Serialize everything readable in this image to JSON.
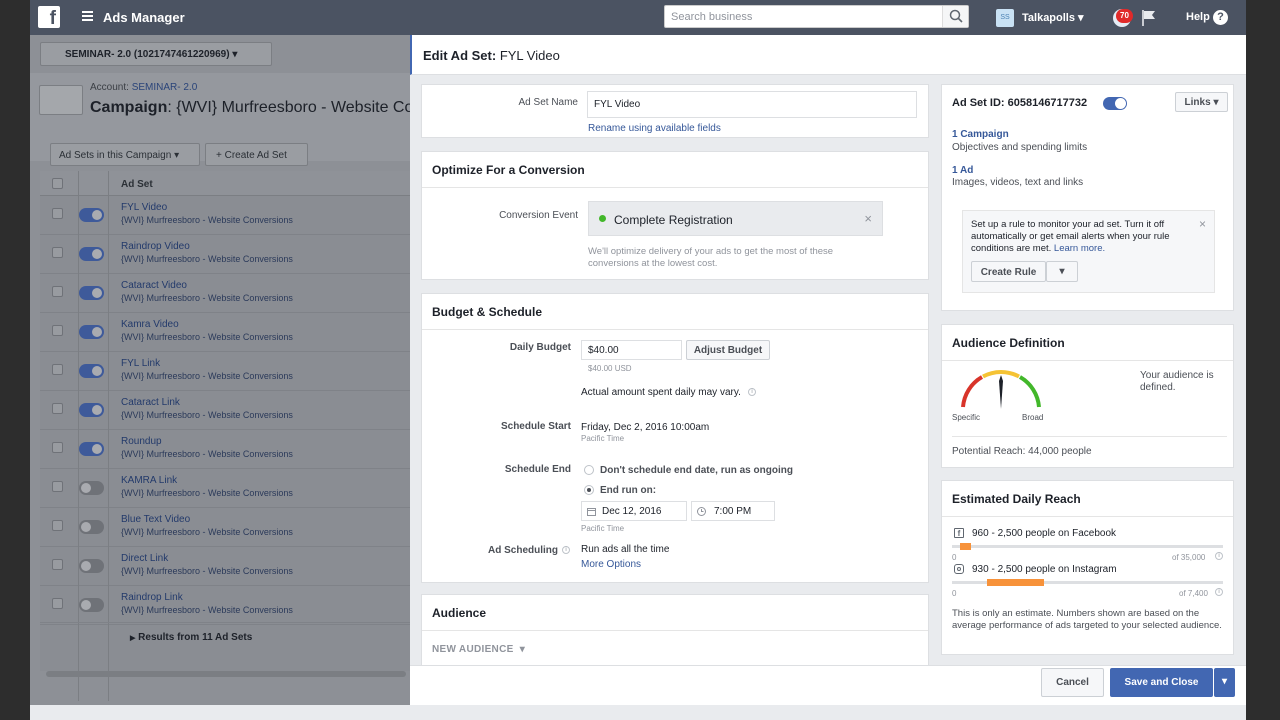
{
  "topbar": {
    "app_title": "Ads Manager",
    "search_placeholder": "Search business",
    "account_initials": "SS",
    "account_name": "Talkapolls",
    "notification_count": "70",
    "help_label": "Help",
    "help_icon": "?"
  },
  "background": {
    "campaign_selector": "SEMINAR- 2.0 (1021747461220969)",
    "account_label": "Account:",
    "account_name": "SEMINAR- 2.0",
    "campaign_label": "Campaign",
    "campaign_name": ": {WVI} Murfreesboro - Website Conv",
    "adsets_button": "Ad Sets in this Campaign",
    "create_button": "Create Ad Set",
    "table_header": "Ad Set",
    "rows": [
      {
        "name": "FYL Video",
        "campaign": "{WVI} Murfreesboro - Website Conversions",
        "active": true
      },
      {
        "name": "Raindrop Video",
        "campaign": "{WVI} Murfreesboro - Website Conversions",
        "active": true
      },
      {
        "name": "Cataract Video",
        "campaign": "{WVI} Murfreesboro - Website Conversions",
        "active": true
      },
      {
        "name": "Kamra Video",
        "campaign": "{WVI} Murfreesboro - Website Conversions",
        "active": true
      },
      {
        "name": "FYL Link",
        "campaign": "{WVI} Murfreesboro - Website Conversions",
        "active": true
      },
      {
        "name": "Cataract Link",
        "campaign": "{WVI} Murfreesboro - Website Conversions",
        "active": true
      },
      {
        "name": "Roundup",
        "campaign": "{WVI} Murfreesboro - Website Conversions",
        "active": true
      },
      {
        "name": "KAMRA Link",
        "campaign": "{WVI} Murfreesboro - Website Conversions",
        "active": false
      },
      {
        "name": "Blue Text Video",
        "campaign": "{WVI} Murfreesboro - Website Conversions",
        "active": false
      },
      {
        "name": "Direct Link",
        "campaign": "{WVI} Murfreesboro - Website Conversions",
        "active": false
      },
      {
        "name": "Raindrop Link",
        "campaign": "{WVI} Murfreesboro - Website Conversions",
        "active": false
      }
    ],
    "results_row": "Results from 11 Ad Sets"
  },
  "panel": {
    "title_prefix": "Edit Ad Set:",
    "title_name": "FYL Video",
    "adset_name_label": "Ad Set Name",
    "adset_name_value": "FYL Video",
    "rename_link": "Rename using available fields",
    "optimize": {
      "heading": "Optimize For a Conversion",
      "event_label": "Conversion Event",
      "event_value": "Complete Registration",
      "note": "We'll optimize delivery of your ads to get the most of these conversions at the lowest cost."
    },
    "budget": {
      "heading": "Budget & Schedule",
      "daily_label": "Daily Budget",
      "daily_value": "$40.00",
      "daily_sub": "$40.00 USD",
      "adjust_button": "Adjust Budget",
      "actual_note": "Actual amount spent daily may vary.",
      "start_label": "Schedule Start",
      "start_value": "Friday, Dec 2, 2016 10:00am",
      "start_tz": "Pacific Time",
      "end_label": "Schedule End",
      "end_option1": "Don't schedule end date, run as ongoing",
      "end_option2": "End run on:",
      "end_date": "Dec 12, 2016",
      "end_time": "7:00 PM",
      "end_tz": "Pacific Time",
      "scheduling_label": "Ad Scheduling",
      "scheduling_value": "Run ads all the time",
      "more_options": "More Options"
    },
    "audience": {
      "heading": "Audience",
      "new_audience": "NEW AUDIENCE"
    },
    "summary": {
      "adset_id": "Ad Set ID: 6058146717732",
      "links_button": "Links",
      "campaign_link": "1 Campaign",
      "campaign_desc": "Objectives and spending limits",
      "ad_link": "1 Ad",
      "ad_desc": "Images, videos, text and links",
      "rule_text": "Set up a rule to monitor your ad set. Turn it off automatically or get email alerts when your rule conditions are met.",
      "learn_more": "Learn more.",
      "create_rule": "Create Rule"
    },
    "audience_def": {
      "heading": "Audience Definition",
      "status": "Your audience is defined.",
      "specific": "Specific",
      "broad": "Broad",
      "gauge_level": 0.5,
      "reach": "Potential Reach: 44,000 people"
    },
    "daily_reach": {
      "heading": "Estimated Daily Reach",
      "facebook": "960 - 2,500 people on Facebook",
      "facebook_min": "0",
      "facebook_max": "of 35,000",
      "facebook_range": [
        0.03,
        0.07
      ],
      "instagram": "930 - 2,500 people on Instagram",
      "instagram_min": "0",
      "instagram_max": "of 7,400",
      "instagram_range": [
        0.13,
        0.34
      ],
      "note": "This is only an estimate. Numbers shown are based on the average performance of ads targeted to your selected audience."
    },
    "footer": {
      "cancel": "Cancel",
      "save": "Save and Close"
    }
  },
  "colors": {
    "topbar": "#4b5362",
    "primary": "#4267b2",
    "link": "#365899",
    "reach_bar": "#f7923a",
    "event_dot": "#42b72a"
  }
}
